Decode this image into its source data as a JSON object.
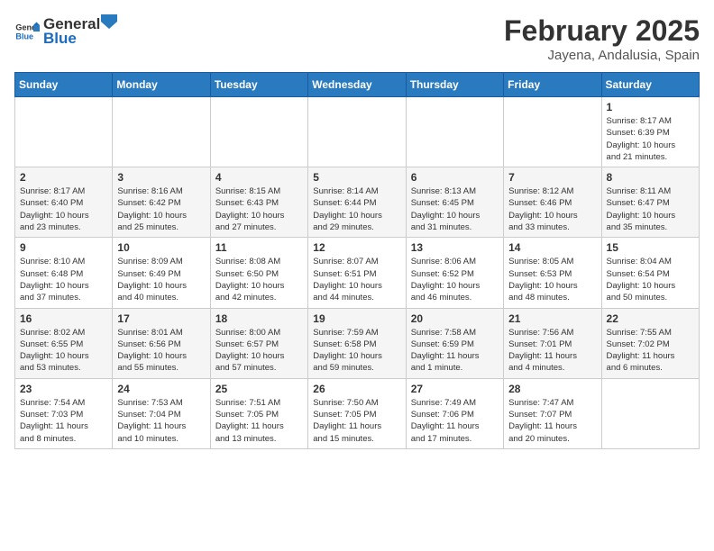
{
  "header": {
    "logo_general": "General",
    "logo_blue": "Blue",
    "month": "February 2025",
    "location": "Jayena, Andalusia, Spain"
  },
  "days_of_week": [
    "Sunday",
    "Monday",
    "Tuesday",
    "Wednesday",
    "Thursday",
    "Friday",
    "Saturday"
  ],
  "weeks": [
    [
      {
        "day": "",
        "info": ""
      },
      {
        "day": "",
        "info": ""
      },
      {
        "day": "",
        "info": ""
      },
      {
        "day": "",
        "info": ""
      },
      {
        "day": "",
        "info": ""
      },
      {
        "day": "",
        "info": ""
      },
      {
        "day": "1",
        "info": "Sunrise: 8:17 AM\nSunset: 6:39 PM\nDaylight: 10 hours\nand 21 minutes."
      }
    ],
    [
      {
        "day": "2",
        "info": "Sunrise: 8:17 AM\nSunset: 6:40 PM\nDaylight: 10 hours\nand 23 minutes."
      },
      {
        "day": "3",
        "info": "Sunrise: 8:16 AM\nSunset: 6:42 PM\nDaylight: 10 hours\nand 25 minutes."
      },
      {
        "day": "4",
        "info": "Sunrise: 8:15 AM\nSunset: 6:43 PM\nDaylight: 10 hours\nand 27 minutes."
      },
      {
        "day": "5",
        "info": "Sunrise: 8:14 AM\nSunset: 6:44 PM\nDaylight: 10 hours\nand 29 minutes."
      },
      {
        "day": "6",
        "info": "Sunrise: 8:13 AM\nSunset: 6:45 PM\nDaylight: 10 hours\nand 31 minutes."
      },
      {
        "day": "7",
        "info": "Sunrise: 8:12 AM\nSunset: 6:46 PM\nDaylight: 10 hours\nand 33 minutes."
      },
      {
        "day": "8",
        "info": "Sunrise: 8:11 AM\nSunset: 6:47 PM\nDaylight: 10 hours\nand 35 minutes."
      }
    ],
    [
      {
        "day": "9",
        "info": "Sunrise: 8:10 AM\nSunset: 6:48 PM\nDaylight: 10 hours\nand 37 minutes."
      },
      {
        "day": "10",
        "info": "Sunrise: 8:09 AM\nSunset: 6:49 PM\nDaylight: 10 hours\nand 40 minutes."
      },
      {
        "day": "11",
        "info": "Sunrise: 8:08 AM\nSunset: 6:50 PM\nDaylight: 10 hours\nand 42 minutes."
      },
      {
        "day": "12",
        "info": "Sunrise: 8:07 AM\nSunset: 6:51 PM\nDaylight: 10 hours\nand 44 minutes."
      },
      {
        "day": "13",
        "info": "Sunrise: 8:06 AM\nSunset: 6:52 PM\nDaylight: 10 hours\nand 46 minutes."
      },
      {
        "day": "14",
        "info": "Sunrise: 8:05 AM\nSunset: 6:53 PM\nDaylight: 10 hours\nand 48 minutes."
      },
      {
        "day": "15",
        "info": "Sunrise: 8:04 AM\nSunset: 6:54 PM\nDaylight: 10 hours\nand 50 minutes."
      }
    ],
    [
      {
        "day": "16",
        "info": "Sunrise: 8:02 AM\nSunset: 6:55 PM\nDaylight: 10 hours\nand 53 minutes."
      },
      {
        "day": "17",
        "info": "Sunrise: 8:01 AM\nSunset: 6:56 PM\nDaylight: 10 hours\nand 55 minutes."
      },
      {
        "day": "18",
        "info": "Sunrise: 8:00 AM\nSunset: 6:57 PM\nDaylight: 10 hours\nand 57 minutes."
      },
      {
        "day": "19",
        "info": "Sunrise: 7:59 AM\nSunset: 6:58 PM\nDaylight: 10 hours\nand 59 minutes."
      },
      {
        "day": "20",
        "info": "Sunrise: 7:58 AM\nSunset: 6:59 PM\nDaylight: 11 hours\nand 1 minute."
      },
      {
        "day": "21",
        "info": "Sunrise: 7:56 AM\nSunset: 7:01 PM\nDaylight: 11 hours\nand 4 minutes."
      },
      {
        "day": "22",
        "info": "Sunrise: 7:55 AM\nSunset: 7:02 PM\nDaylight: 11 hours\nand 6 minutes."
      }
    ],
    [
      {
        "day": "23",
        "info": "Sunrise: 7:54 AM\nSunset: 7:03 PM\nDaylight: 11 hours\nand 8 minutes."
      },
      {
        "day": "24",
        "info": "Sunrise: 7:53 AM\nSunset: 7:04 PM\nDaylight: 11 hours\nand 10 minutes."
      },
      {
        "day": "25",
        "info": "Sunrise: 7:51 AM\nSunset: 7:05 PM\nDaylight: 11 hours\nand 13 minutes."
      },
      {
        "day": "26",
        "info": "Sunrise: 7:50 AM\nSunset: 7:05 PM\nDaylight: 11 hours\nand 15 minutes."
      },
      {
        "day": "27",
        "info": "Sunrise: 7:49 AM\nSunset: 7:06 PM\nDaylight: 11 hours\nand 17 minutes."
      },
      {
        "day": "28",
        "info": "Sunrise: 7:47 AM\nSunset: 7:07 PM\nDaylight: 11 hours\nand 20 minutes."
      },
      {
        "day": "",
        "info": ""
      }
    ]
  ]
}
